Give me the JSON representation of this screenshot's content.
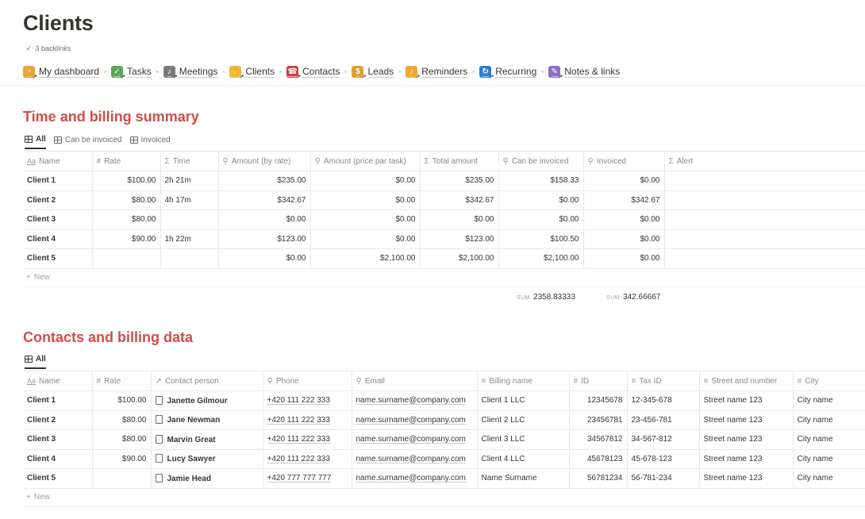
{
  "page": {
    "title": "Clients",
    "backlinks": "3 backlinks"
  },
  "nav": [
    {
      "label": "My dashboard",
      "icon": "clock-icon",
      "color": "#e8a23a"
    },
    {
      "label": "Tasks",
      "icon": "checkmark-icon",
      "color": "#5aa55a"
    },
    {
      "label": "Meetings",
      "icon": "microphone-icon",
      "color": "#7a7a7a"
    },
    {
      "label": "Clients",
      "icon": "handshake-icon",
      "color": "#f1b73c"
    },
    {
      "label": "Contacts",
      "icon": "telephone-icon",
      "color": "#d23b3b"
    },
    {
      "label": "Leads",
      "icon": "money-bag-icon",
      "color": "#d8a033"
    },
    {
      "label": "Reminders",
      "icon": "bell-icon",
      "color": "#f0a92d"
    },
    {
      "label": "Recurring",
      "icon": "repeat-icon",
      "color": "#2e7fd0"
    },
    {
      "label": "Notes & links",
      "icon": "memo-icon",
      "color": "#8b6fc4"
    }
  ],
  "billing": {
    "title": "Time and billing summary",
    "views": [
      "All",
      "Can be invoiced",
      "Invoiced"
    ],
    "headers": [
      {
        "icon": "Aa",
        "label": "Name"
      },
      {
        "icon": "#",
        "label": "Rate"
      },
      {
        "icon": "Σ",
        "label": "Time"
      },
      {
        "icon": "⚲",
        "label": "Amount (by rate)"
      },
      {
        "icon": "⚲",
        "label": "Amount (price par task)"
      },
      {
        "icon": "Σ",
        "label": "Total amount"
      },
      {
        "icon": "⚲",
        "label": "Can be invoiced"
      },
      {
        "icon": "⚲",
        "label": "Invoiced"
      },
      {
        "icon": "Σ",
        "label": "Alert"
      }
    ],
    "rows": [
      [
        "Client 1",
        "$100.00",
        "2h 21m",
        "$235.00",
        "$0.00",
        "$235.00",
        "$158.33",
        "$0.00",
        ""
      ],
      [
        "Client 2",
        "$80.00",
        "4h 17m",
        "$342.67",
        "$0.00",
        "$342.67",
        "$0.00",
        "$342.67",
        ""
      ],
      [
        "Client 3",
        "$80.00",
        "",
        "$0.00",
        "$0.00",
        "$0.00",
        "$0.00",
        "$0.00",
        ""
      ],
      [
        "Client 4",
        "$90.00",
        "1h 22m",
        "$123.00",
        "$0.00",
        "$123.00",
        "$100.50",
        "$0.00",
        ""
      ],
      [
        "Client 5",
        "",
        "",
        "$0.00",
        "$2,100.00",
        "$2,100.00",
        "$2,100.00",
        "$0.00",
        ""
      ]
    ],
    "new_label": "New",
    "sum_label": "SUM",
    "sum_can_be_invoiced": "2358.83333",
    "sum_invoiced": "342.66667"
  },
  "contacts": {
    "title": "Contacts and billing data",
    "views": [
      "All"
    ],
    "headers": [
      {
        "icon": "Aa",
        "label": "Name"
      },
      {
        "icon": "#",
        "label": "Rate"
      },
      {
        "icon": "↗",
        "label": "Contact person"
      },
      {
        "icon": "⚲",
        "label": "Phone"
      },
      {
        "icon": "⚲",
        "label": "Email"
      },
      {
        "icon": "≡",
        "label": "Billing name"
      },
      {
        "icon": "#",
        "label": "ID"
      },
      {
        "icon": "≡",
        "label": "Tax ID"
      },
      {
        "icon": "≡",
        "label": "Street and number"
      },
      {
        "icon": "≡",
        "label": "City"
      }
    ],
    "rows": [
      [
        "Client 1",
        "$100.00",
        "Janette Gilmour",
        "+420 111 222 333",
        "name.surname@company.com",
        "Client 1 LLC",
        "12345678",
        "12-345-678",
        "Street name 123",
        "City name"
      ],
      [
        "Client 2",
        "$80.00",
        "Jane Newman",
        "+420 111 222 333",
        "name.surname@company.com",
        "Client 2 LLC",
        "23456781",
        "23-456-781",
        "Street name 123",
        "City name"
      ],
      [
        "Client 3",
        "$80.00",
        "Marvin Great",
        "+420 111 222 333",
        "name.surname@company.com",
        "Client 3 LLC",
        "34567812",
        "34-567-812",
        "Street name 123",
        "City name"
      ],
      [
        "Client 4",
        "$90.00",
        "Lucy Sawyer",
        "+420 111 222 333",
        "name.surname@company.com",
        "Client 4 LLC",
        "45678123",
        "45-678-123",
        "Street name 123",
        "City name"
      ],
      [
        "Client 5",
        "",
        "Jamie Head",
        "+420 777 777 777",
        "name.surname@company.com",
        "Name Surname",
        "56781234",
        "56-781-234",
        "Street name 123",
        "City name"
      ]
    ],
    "new_label": "New"
  }
}
